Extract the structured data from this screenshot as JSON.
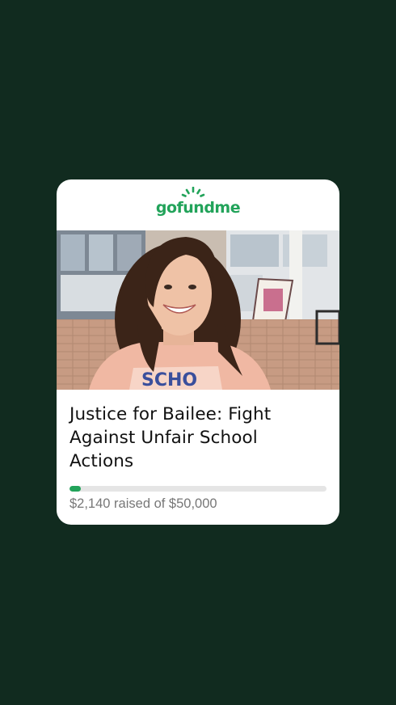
{
  "brand": {
    "logo_text": "gofundme",
    "accent_color": "#22a35a",
    "background_color": "#112b1f"
  },
  "campaign": {
    "image_icon": "campaign-photo",
    "title": "Justice for Bailee: Fight Against Unfair School Actions",
    "raised_text": "$2,140 raised of $50,000",
    "raised_amount": 2140,
    "goal_amount": 50000,
    "progress_fraction": 0.0428
  }
}
